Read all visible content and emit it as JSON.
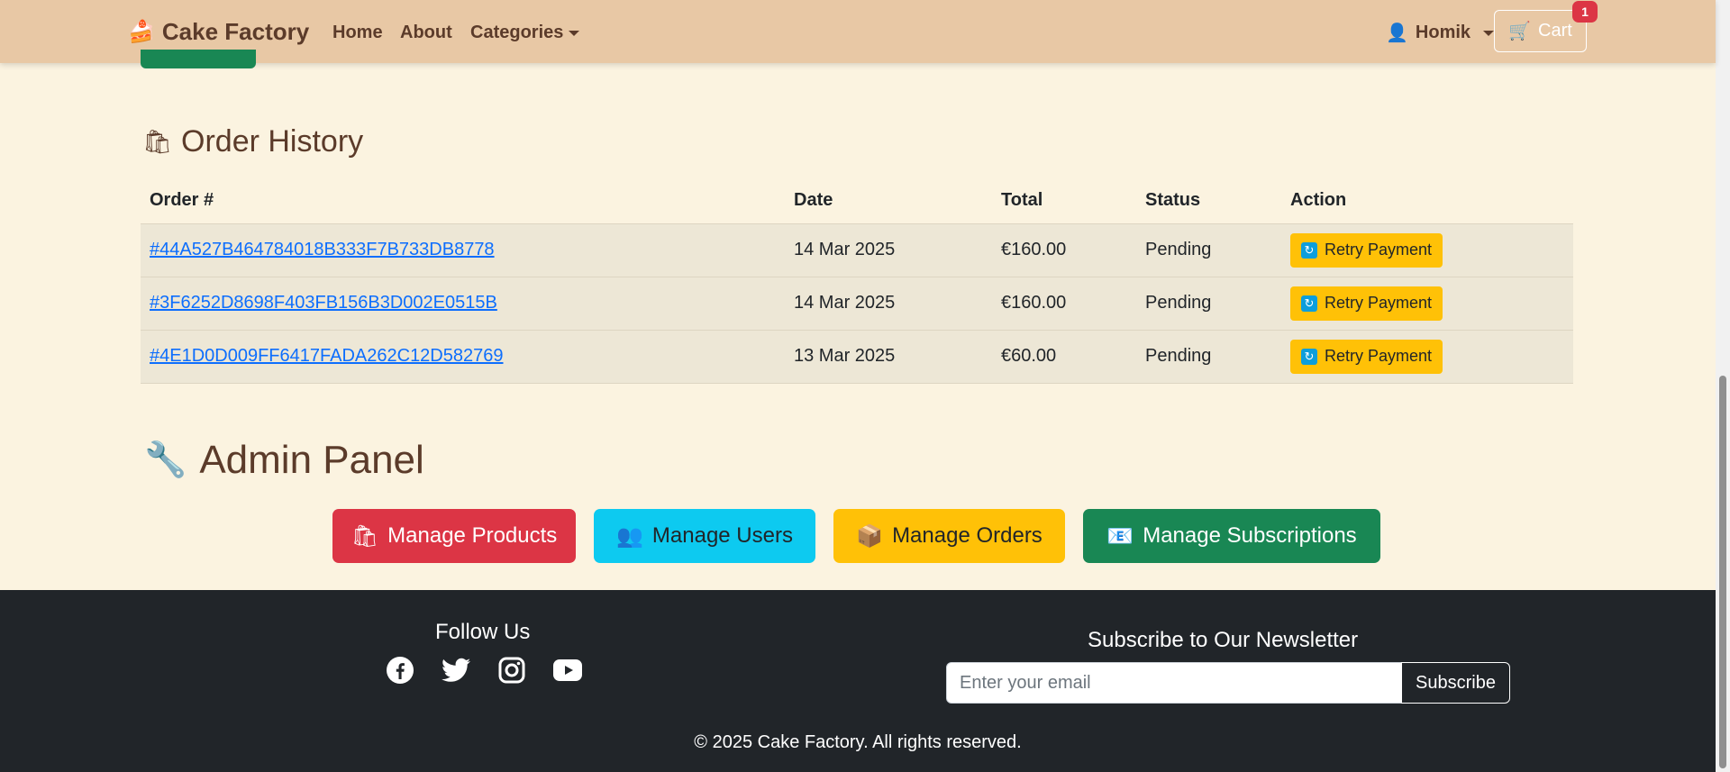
{
  "navbar": {
    "brand_icon": "🍰",
    "brand": "Cake Factory",
    "home": "Home",
    "about": "About",
    "categories": "Categories",
    "user_icon": "👤",
    "user": "Homik",
    "cart_icon": "🛒",
    "cart": "Cart",
    "cart_count": "1"
  },
  "orders": {
    "icon": "🛍",
    "title": "Order History",
    "headers": [
      "Order #",
      "Date",
      "Total",
      "Status",
      "Action"
    ],
    "rows": [
      {
        "id": "#44A527B464784018B333F7B733DB8778",
        "date": "14 Mar 2025",
        "total": "€160.00",
        "status": "Pending",
        "action": "Retry Payment"
      },
      {
        "id": "#3F6252D8698F403FB156B3D002E0515B",
        "date": "14 Mar 2025",
        "total": "€160.00",
        "status": "Pending",
        "action": "Retry Payment"
      },
      {
        "id": "#4E1D0D009FF6417FADA262C12D582769",
        "date": "13 Mar 2025",
        "total": "€60.00",
        "status": "Pending",
        "action": "Retry Payment"
      }
    ],
    "retry_icon": "🔄"
  },
  "admin": {
    "icon": "🔧",
    "title": "Admin Panel",
    "buttons": {
      "products": {
        "icon": "🛍",
        "label": "Manage Products"
      },
      "users": {
        "icon": "👥",
        "label": "Manage Users"
      },
      "orders": {
        "icon": "📦",
        "label": "Manage Orders"
      },
      "subscriptions": {
        "icon": "📧",
        "label": "Manage Subscriptions"
      }
    }
  },
  "footer": {
    "follow_title": "Follow Us",
    "social_icons": [
      "facebook-icon",
      "twitter-icon",
      "instagram-icon",
      "youtube-icon"
    ],
    "newsletter_title": "Subscribe to Our Newsletter",
    "email_placeholder": "Enter your email",
    "subscribe": "Subscribe",
    "copyright": "© 2025 Cake Factory. All rights reserved."
  },
  "colors": {
    "page_bg": "#fbf3e0",
    "navbar_bg": "#e8c8a5",
    "brand_text": "#5b3b2a",
    "danger": "#dc3545",
    "info": "#0dcaf0",
    "warning": "#ffc107",
    "success": "#198754",
    "footer_bg": "#212529",
    "link": "#0d6efd"
  }
}
